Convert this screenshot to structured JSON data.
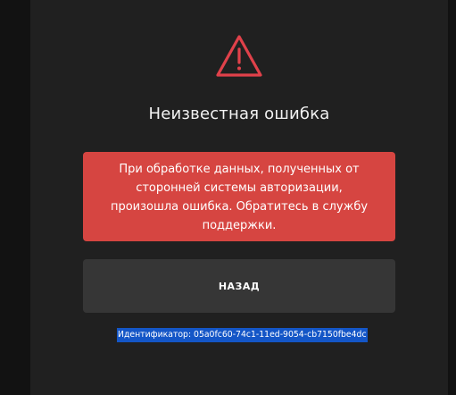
{
  "icon": {
    "name": "warning-triangle-icon",
    "color": "#e0414a"
  },
  "title": "Неизвестная ошибка",
  "error_message": "При обработке данных, полученных от сторонней системы авторизации, произошла ошибка. Обратитесь в службу поддержки.",
  "back_button_label": "НАЗАД",
  "identifier_text": "Идентификатор: 05a0fc60-74c1-11ed-9054-cb7150fbe4dc",
  "colors": {
    "background": "#121212",
    "card": "#202020",
    "error_box": "#d64541",
    "button": "#363636",
    "selection_highlight": "#1456c7"
  }
}
